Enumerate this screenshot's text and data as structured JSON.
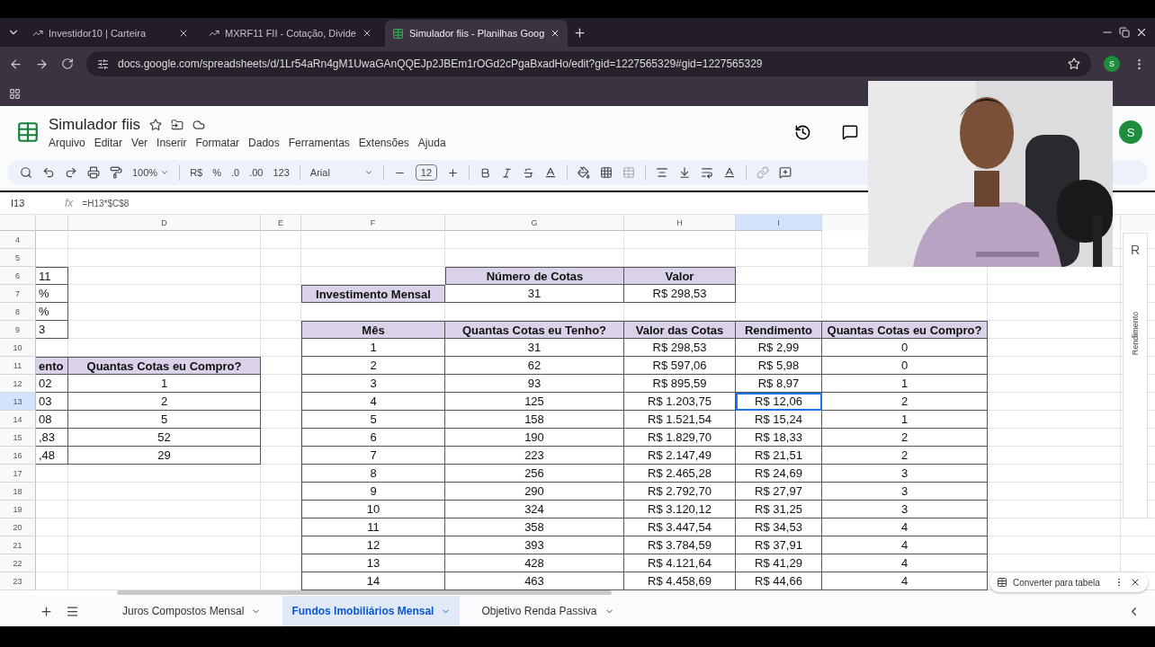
{
  "browser": {
    "tabs": [
      {
        "title": "Investidor10 | Carteira",
        "selected": false
      },
      {
        "title": "MXRF11 FII - Cotação, Divide",
        "selected": false
      },
      {
        "title": "Simulador fiis - Planilhas Goog",
        "selected": true
      }
    ],
    "url": "docs.google.com/spreadsheets/d/1Lr54aRn4gM1UwaGAnQQEJp2JBEm1rOGd2cPgaBxadHo/edit?gid=1227565329#gid=1227565329",
    "profile": "S"
  },
  "doc": {
    "title": "Simulador fiis",
    "menu": [
      "Arquivo",
      "Editar",
      "Ver",
      "Inserir",
      "Formatar",
      "Dados",
      "Ferramentas",
      "Extensões",
      "Ajuda"
    ],
    "avatar": "S"
  },
  "toolbar": {
    "zoom": "100%",
    "currency": "R$",
    "percent": "%",
    "decrease_decimals": ".0",
    "increase_decimals": ".00",
    "number_format": "123",
    "font": "Arial",
    "font_size": "12"
  },
  "formula_bar": {
    "cell_ref": "I13",
    "fx_label": "fx",
    "formula": "=H13*$C$8"
  },
  "sheet": {
    "column_headers": [
      {
        "label": "D",
        "selected": false
      },
      {
        "label": "E",
        "selected": false
      },
      {
        "label": "F",
        "selected": false
      },
      {
        "label": "G",
        "selected": false
      },
      {
        "label": "H",
        "selected": false
      },
      {
        "label": "I",
        "selected": true
      }
    ],
    "row_numbers": [
      {
        "number": "4",
        "selected": false
      },
      {
        "number": "5",
        "selected": false
      },
      {
        "number": "6",
        "selected": false
      },
      {
        "number": "7",
        "selected": false
      },
      {
        "number": "8",
        "selected": false
      },
      {
        "number": "9",
        "selected": false
      },
      {
        "number": "10",
        "selected": false
      },
      {
        "number": "11",
        "selected": false
      },
      {
        "number": "12",
        "selected": false
      },
      {
        "number": "13",
        "selected": true
      },
      {
        "number": "14",
        "selected": false
      },
      {
        "number": "15",
        "selected": false
      },
      {
        "number": "16",
        "selected": false
      },
      {
        "number": "17",
        "selected": false
      },
      {
        "number": "18",
        "selected": false
      },
      {
        "number": "19",
        "selected": false
      },
      {
        "number": "20",
        "selected": false
      },
      {
        "number": "21",
        "selected": false
      },
      {
        "number": "22",
        "selected": false
      },
      {
        "number": "23",
        "selected": false
      }
    ],
    "params": [
      "11",
      "%",
      "%",
      "3"
    ],
    "purchase_table": {
      "columns": [
        "ento",
        "Quantas Cotas eu Compro?"
      ],
      "rows": [
        [
          "02",
          "1"
        ],
        [
          "03",
          "2"
        ],
        [
          "08",
          "5"
        ],
        [
          ",83",
          "52"
        ],
        [
          ",48",
          "29"
        ]
      ]
    },
    "summary": {
      "columns": [
        "Número de Cotas",
        "Valor"
      ],
      "label": "Investimento Mensal",
      "values": [
        "31",
        "R$ 298,53"
      ]
    },
    "main_table": {
      "columns": [
        "Mês",
        "Quantas Cotas eu Tenho?",
        "Valor das Cotas",
        "Rendimento",
        "Quantas Cotas eu Compro?"
      ],
      "rows": [
        [
          "1",
          "31",
          "R$ 298,53",
          "R$ 2,99",
          "0"
        ],
        [
          "2",
          "62",
          "R$ 597,06",
          "R$ 5,98",
          "0"
        ],
        [
          "3",
          "93",
          "R$ 895,59",
          "R$ 8,97",
          "1"
        ],
        [
          "4",
          "125",
          "R$ 1.203,75",
          "R$ 12,06",
          "2"
        ],
        [
          "5",
          "158",
          "R$ 1.521,54",
          "R$ 15,24",
          "1"
        ],
        [
          "6",
          "190",
          "R$ 1.829,70",
          "R$ 18,33",
          "2"
        ],
        [
          "7",
          "223",
          "R$ 2.147,49",
          "R$ 21,51",
          "2"
        ],
        [
          "8",
          "256",
          "R$ 2.465,28",
          "R$ 24,69",
          "3"
        ],
        [
          "9",
          "290",
          "R$ 2.792,70",
          "R$ 27,97",
          "3"
        ],
        [
          "10",
          "324",
          "R$ 3.120,12",
          "R$ 31,25",
          "3"
        ],
        [
          "11",
          "358",
          "R$ 3.447,54",
          "R$ 34,53",
          "4"
        ],
        [
          "12",
          "393",
          "R$ 3.784,59",
          "R$ 37,91",
          "4"
        ],
        [
          "13",
          "428",
          "R$ 4.121,64",
          "R$ 41,29",
          "4"
        ],
        [
          "14",
          "463",
          "R$ 4.458,69",
          "R$ 44,66",
          "4"
        ]
      ]
    },
    "side_chart": {
      "letter": "R",
      "axis_label": "Rendimento"
    }
  },
  "sheet_tabs": [
    {
      "label": "Juros Compostos Mensal",
      "selected": false
    },
    {
      "label": "Fundos Imobiliários Mensal",
      "selected": true
    },
    {
      "label": "Objetivo Renda Passiva",
      "selected": false
    }
  ],
  "convert_chip": {
    "label": "Converter para tabela"
  }
}
